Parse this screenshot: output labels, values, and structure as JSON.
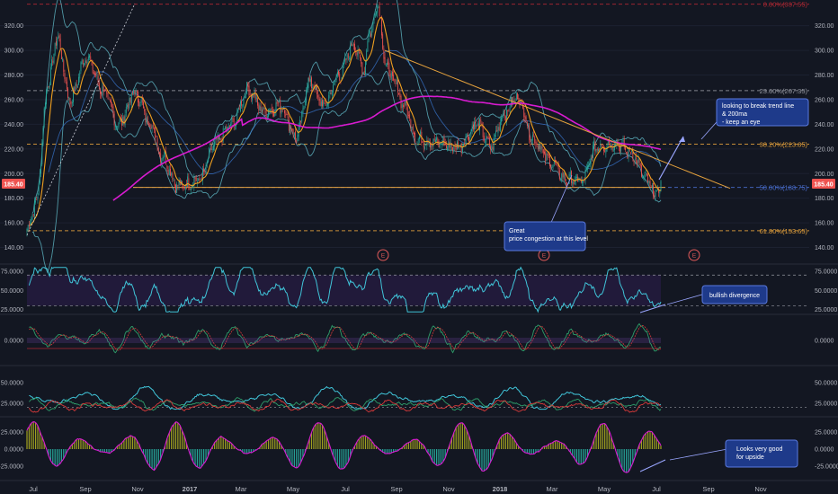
{
  "chart_data": [
    {
      "type": "candlestick",
      "panel": "price",
      "ylim": [
        128,
        338
      ],
      "y_ticks": [
        140,
        160,
        180,
        200,
        220,
        240,
        260,
        280,
        300,
        320
      ],
      "y_tick_labels": [
        "140.00",
        "160.00",
        "180.00",
        "200.00",
        "220.00",
        "240.00",
        "260.00",
        "280.00",
        "300.00",
        "320.00"
      ],
      "last_price": "185.40",
      "price_key_points": [
        {
          "t": 0,
          "v": 155
        },
        {
          "t": 8,
          "v": 175
        },
        {
          "t": 20,
          "v": 275
        },
        {
          "t": 28,
          "v": 310
        },
        {
          "t": 40,
          "v": 260
        },
        {
          "t": 55,
          "v": 295
        },
        {
          "t": 70,
          "v": 268
        },
        {
          "t": 85,
          "v": 240
        },
        {
          "t": 100,
          "v": 265
        },
        {
          "t": 115,
          "v": 240
        },
        {
          "t": 125,
          "v": 215
        },
        {
          "t": 140,
          "v": 190
        },
        {
          "t": 160,
          "v": 195
        },
        {
          "t": 175,
          "v": 225
        },
        {
          "t": 190,
          "v": 240
        },
        {
          "t": 205,
          "v": 268
        },
        {
          "t": 220,
          "v": 250
        },
        {
          "t": 235,
          "v": 255
        },
        {
          "t": 250,
          "v": 230
        },
        {
          "t": 262,
          "v": 275
        },
        {
          "t": 275,
          "v": 255
        },
        {
          "t": 290,
          "v": 280
        },
        {
          "t": 303,
          "v": 305
        },
        {
          "t": 312,
          "v": 285
        },
        {
          "t": 318,
          "v": 315
        },
        {
          "t": 326,
          "v": 338
        },
        {
          "t": 332,
          "v": 290
        },
        {
          "t": 340,
          "v": 275
        },
        {
          "t": 350,
          "v": 255
        },
        {
          "t": 362,
          "v": 228
        },
        {
          "t": 380,
          "v": 225
        },
        {
          "t": 400,
          "v": 222
        },
        {
          "t": 418,
          "v": 240
        },
        {
          "t": 430,
          "v": 222
        },
        {
          "t": 442,
          "v": 248
        },
        {
          "t": 455,
          "v": 262
        },
        {
          "t": 470,
          "v": 228
        },
        {
          "t": 485,
          "v": 210
        },
        {
          "t": 500,
          "v": 195
        },
        {
          "t": 515,
          "v": 194
        },
        {
          "t": 528,
          "v": 222
        },
        {
          "t": 545,
          "v": 225
        },
        {
          "t": 560,
          "v": 217
        },
        {
          "t": 575,
          "v": 195
        },
        {
          "t": 582,
          "v": 183
        },
        {
          "t": 588,
          "v": 189
        }
      ],
      "bars_count": 589,
      "fib_levels": [
        {
          "label": "0.00%(337.55)",
          "value": 337.55,
          "color": "#b22833"
        },
        {
          "label": "23.60%(267.35)",
          "value": 267.35,
          "color": "#9598a1"
        },
        {
          "label": "38.20%(223.85)",
          "value": 223.85,
          "color": "#e6a23c"
        },
        {
          "label": "50.00%(188.75)",
          "value": 188.75,
          "color": "#4a6fd1"
        },
        {
          "label": "61.80%(153.65)",
          "value": 153.65,
          "color": "#e6a23c"
        }
      ],
      "series": [
        {
          "name": "",
          "kind": "candles",
          "up_color": "#26a69a",
          "down_color": "#ef5350"
        },
        {
          "name": "",
          "kind": "ma_fast",
          "color": "#f0a020"
        },
        {
          "name": "",
          "kind": "ma_200",
          "color": "#d81bd0"
        },
        {
          "name": "",
          "kind": "bollinger",
          "color": "#5fb8c6"
        }
      ],
      "event_markers": [
        "E",
        "E",
        "E"
      ]
    },
    {
      "type": "line",
      "panel": "rsi",
      "ylim": [
        20,
        82
      ],
      "y_ticks": [
        25,
        50,
        75
      ],
      "y_tick_labels": [
        "25.0000",
        "50.0000",
        "75.0000"
      ],
      "levels": [
        70,
        30
      ],
      "series": [
        {
          "name": "",
          "color": "#40c4d8"
        }
      ]
    },
    {
      "type": "line",
      "panel": "macd",
      "ylim": [
        -1,
        1
      ],
      "y_ticks": [
        0
      ],
      "y_tick_labels": [
        "0.0000"
      ],
      "series": [
        {
          "name": "",
          "color": "#2e9e6a"
        },
        {
          "name": "",
          "color": "#d83a3a"
        }
      ]
    },
    {
      "type": "line",
      "panel": "dmi",
      "ylim": [
        10,
        68
      ],
      "y_ticks": [
        25,
        50
      ],
      "y_tick_labels": [
        "25.0000",
        "50.0000"
      ],
      "series": [
        {
          "name": "",
          "color": "#40c4d8"
        },
        {
          "name": "",
          "color": "#2e9e6a"
        },
        {
          "name": "",
          "color": "#d83a3a"
        }
      ]
    },
    {
      "type": "bar",
      "panel": "oscillator",
      "ylim": [
        -45,
        45
      ],
      "y_ticks": [
        25,
        0,
        -25
      ],
      "y_tick_labels": [
        "25.0000",
        "0.0000",
        "-25.0000"
      ],
      "series": [
        {
          "name": "",
          "pos_color": "#a0a020",
          "neg_color": "#26a69a",
          "line_color": "#d81bd0"
        }
      ]
    }
  ],
  "time_axis": {
    "labels": [
      "Jul",
      "Sep",
      "Nov",
      "2017",
      "Mar",
      "May",
      "Jul",
      "Sep",
      "Nov",
      "2018",
      "Mar",
      "May",
      "Jul",
      "Sep",
      "Nov"
    ],
    "bold": [
      "2017",
      "2018"
    ]
  },
  "annotations": {
    "trend": "looking to break trend line & 200ma - keep an eye",
    "congestion": "Great price congestion at this level",
    "rsi": "bullish divergence",
    "osc": "Looks very good for upside"
  },
  "colors": {
    "background": "#131722",
    "panel_border": "#2a2e39",
    "annotation_fill": "#1e3a8a",
    "annotation_border": "#5a7ae0",
    "grid": "#1f2430"
  }
}
